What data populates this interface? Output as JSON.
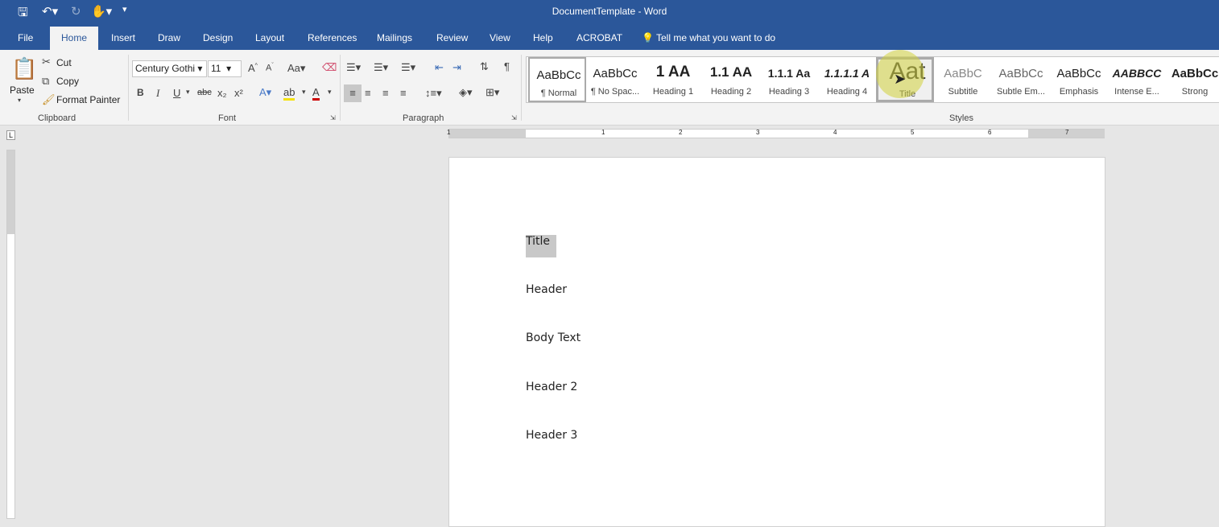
{
  "window": {
    "title": "DocumentTemplate  -  Word"
  },
  "quick_access": {
    "save": "save-icon",
    "undo": "undo-icon",
    "redo": "redo-icon",
    "touch": "touch-mode-icon",
    "customize": "customize-icon"
  },
  "tabs": [
    "File",
    "Home",
    "Insert",
    "Draw",
    "Design",
    "Layout",
    "References",
    "Mailings",
    "Review",
    "View",
    "Help",
    "ACROBAT"
  ],
  "active_tab": "Home",
  "tell_me": "Tell me what you want to do",
  "clipboard": {
    "label": "Clipboard",
    "paste": "Paste",
    "cut": "Cut",
    "copy": "Copy",
    "format_painter": "Format Painter"
  },
  "font": {
    "label": "Font",
    "family": "Century Gothi",
    "size": "11",
    "bold": "B",
    "italic": "I",
    "underline": "U",
    "strike": "abc",
    "sub": "x₂",
    "sup": "x²",
    "change_case": "Aa"
  },
  "paragraph": {
    "label": "Paragraph",
    "pilcrow": "¶"
  },
  "styles": {
    "label": "Styles",
    "items": [
      {
        "preview": "AaBbCc",
        "name": "¶ Normal"
      },
      {
        "preview": "AaBbCc",
        "name": "¶ No Spac..."
      },
      {
        "preview": "1  AA",
        "name": "Heading 1"
      },
      {
        "preview": "1.1  AA",
        "name": "Heading 2"
      },
      {
        "preview": "1.1.1  Aa",
        "name": "Heading 3"
      },
      {
        "preview": "1.1.1.1  A",
        "name": "Heading 4"
      },
      {
        "preview": "Aat",
        "name": "Title"
      },
      {
        "preview": "AaBbC",
        "name": "Subtitle"
      },
      {
        "preview": "AaBbCc",
        "name": "Subtle Em..."
      },
      {
        "preview": "AaBbCc",
        "name": "Emphasis"
      },
      {
        "preview": "AABBCC",
        "name": "Intense E..."
      },
      {
        "preview": "AaBbCc",
        "name": "Strong"
      }
    ]
  },
  "ruler": {
    "numbers": [
      "1",
      "1",
      "2",
      "3",
      "4",
      "5",
      "6",
      "7"
    ]
  },
  "document": {
    "paragraphs": [
      "Title",
      "Header",
      "Body Text",
      "Header 2",
      "Header 3"
    ]
  },
  "colors": {
    "accent": "#2b579a",
    "ribbon": "#f3f3f3",
    "selection": "#c8c8c8"
  }
}
